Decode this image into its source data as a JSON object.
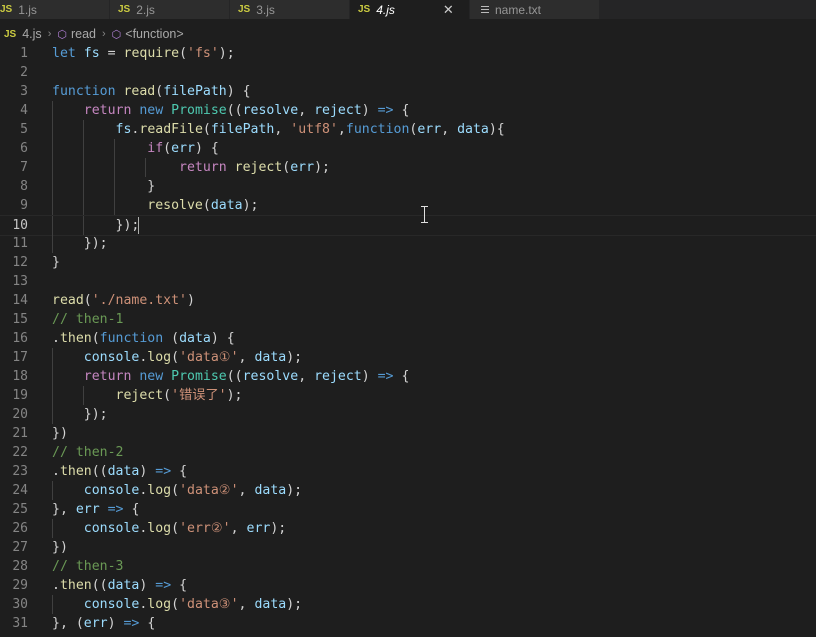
{
  "tabs": [
    {
      "badge": "JS",
      "label": "1.js"
    },
    {
      "badge": "JS",
      "label": "2.js"
    },
    {
      "badge": "JS",
      "label": "3.js"
    },
    {
      "badge": "JS",
      "label": "4.js",
      "active": true
    },
    {
      "icon": "text-file-icon",
      "label": "name.txt"
    }
  ],
  "breadcrumb": {
    "badge": "JS",
    "file": "4.js",
    "symbol1": "read",
    "symbol2": "<function>"
  },
  "editor": {
    "current_line": 10,
    "lines": [
      {
        "n": "1",
        "tokens": [
          [
            "kw",
            "let"
          ],
          [
            "pun",
            " "
          ],
          [
            "var",
            "fs"
          ],
          [
            "pun",
            " = "
          ],
          [
            "fn",
            "require"
          ],
          [
            "pun",
            "("
          ],
          [
            "str",
            "'fs'"
          ],
          [
            "pun",
            ");"
          ]
        ]
      },
      {
        "n": "2",
        "tokens": []
      },
      {
        "n": "3",
        "tokens": [
          [
            "kw",
            "function"
          ],
          [
            "pun",
            " "
          ],
          [
            "fn",
            "read"
          ],
          [
            "pun",
            "("
          ],
          [
            "var",
            "filePath"
          ],
          [
            "pun",
            ") {"
          ]
        ]
      },
      {
        "n": "4",
        "tokens": [
          [
            "pun",
            "    "
          ],
          [
            "ctl",
            "return"
          ],
          [
            "pun",
            " "
          ],
          [
            "kw",
            "new"
          ],
          [
            "pun",
            " "
          ],
          [
            "cls",
            "Promise"
          ],
          [
            "pun",
            "(("
          ],
          [
            "var",
            "resolve"
          ],
          [
            "pun",
            ", "
          ],
          [
            "var",
            "reject"
          ],
          [
            "pun",
            ") "
          ],
          [
            "kw",
            "=>"
          ],
          [
            "pun",
            " {"
          ]
        ]
      },
      {
        "n": "5",
        "tokens": [
          [
            "pun",
            "        "
          ],
          [
            "var",
            "fs"
          ],
          [
            "pun",
            "."
          ],
          [
            "fn",
            "readFile"
          ],
          [
            "pun",
            "("
          ],
          [
            "var",
            "filePath"
          ],
          [
            "pun",
            ", "
          ],
          [
            "str",
            "'utf8'"
          ],
          [
            "pun",
            ","
          ],
          [
            "kw",
            "function"
          ],
          [
            "pun",
            "("
          ],
          [
            "var",
            "err"
          ],
          [
            "pun",
            ", "
          ],
          [
            "var",
            "data"
          ],
          [
            "pun",
            "){"
          ]
        ]
      },
      {
        "n": "6",
        "tokens": [
          [
            "pun",
            "            "
          ],
          [
            "ctl",
            "if"
          ],
          [
            "pun",
            "("
          ],
          [
            "var",
            "err"
          ],
          [
            "pun",
            ") {"
          ]
        ]
      },
      {
        "n": "7",
        "tokens": [
          [
            "pun",
            "                "
          ],
          [
            "ctl",
            "return"
          ],
          [
            "pun",
            " "
          ],
          [
            "fn",
            "reject"
          ],
          [
            "pun",
            "("
          ],
          [
            "var",
            "err"
          ],
          [
            "pun",
            ");"
          ]
        ]
      },
      {
        "n": "8",
        "tokens": [
          [
            "pun",
            "            }"
          ]
        ]
      },
      {
        "n": "9",
        "tokens": [
          [
            "pun",
            "            "
          ],
          [
            "fn",
            "resolve"
          ],
          [
            "pun",
            "("
          ],
          [
            "var",
            "data"
          ],
          [
            "pun",
            ");"
          ]
        ]
      },
      {
        "n": "10",
        "tokens": [
          [
            "pun",
            "        });"
          ]
        ]
      },
      {
        "n": "11",
        "tokens": [
          [
            "pun",
            "    });"
          ]
        ]
      },
      {
        "n": "12",
        "tokens": [
          [
            "pun",
            "}"
          ]
        ]
      },
      {
        "n": "13",
        "tokens": []
      },
      {
        "n": "14",
        "tokens": [
          [
            "fn",
            "read"
          ],
          [
            "pun",
            "("
          ],
          [
            "str",
            "'./name.txt'"
          ],
          [
            "pun",
            ")"
          ]
        ]
      },
      {
        "n": "15",
        "tokens": [
          [
            "com",
            "// then-1"
          ]
        ]
      },
      {
        "n": "16",
        "tokens": [
          [
            "pun",
            "."
          ],
          [
            "fn",
            "then"
          ],
          [
            "pun",
            "("
          ],
          [
            "kw",
            "function"
          ],
          [
            "pun",
            " ("
          ],
          [
            "var",
            "data"
          ],
          [
            "pun",
            ") {"
          ]
        ]
      },
      {
        "n": "17",
        "tokens": [
          [
            "pun",
            "    "
          ],
          [
            "var",
            "console"
          ],
          [
            "pun",
            "."
          ],
          [
            "fn",
            "log"
          ],
          [
            "pun",
            "("
          ],
          [
            "str",
            "'data①'"
          ],
          [
            "pun",
            ", "
          ],
          [
            "var",
            "data"
          ],
          [
            "pun",
            ");"
          ]
        ]
      },
      {
        "n": "18",
        "tokens": [
          [
            "pun",
            "    "
          ],
          [
            "ctl",
            "return"
          ],
          [
            "pun",
            " "
          ],
          [
            "kw",
            "new"
          ],
          [
            "pun",
            " "
          ],
          [
            "cls",
            "Promise"
          ],
          [
            "pun",
            "(("
          ],
          [
            "var",
            "resolve"
          ],
          [
            "pun",
            ", "
          ],
          [
            "var",
            "reject"
          ],
          [
            "pun",
            ") "
          ],
          [
            "kw",
            "=>"
          ],
          [
            "pun",
            " {"
          ]
        ]
      },
      {
        "n": "19",
        "tokens": [
          [
            "pun",
            "        "
          ],
          [
            "fn",
            "reject"
          ],
          [
            "pun",
            "("
          ],
          [
            "str",
            "'错误了'"
          ],
          [
            "pun",
            ");"
          ]
        ]
      },
      {
        "n": "20",
        "tokens": [
          [
            "pun",
            "    });"
          ]
        ]
      },
      {
        "n": "21",
        "tokens": [
          [
            "pun",
            "})"
          ]
        ]
      },
      {
        "n": "22",
        "tokens": [
          [
            "com",
            "// then-2"
          ]
        ]
      },
      {
        "n": "23",
        "tokens": [
          [
            "pun",
            "."
          ],
          [
            "fn",
            "then"
          ],
          [
            "pun",
            "(("
          ],
          [
            "var",
            "data"
          ],
          [
            "pun",
            ") "
          ],
          [
            "kw",
            "=>"
          ],
          [
            "pun",
            " {"
          ]
        ]
      },
      {
        "n": "24",
        "tokens": [
          [
            "pun",
            "    "
          ],
          [
            "var",
            "console"
          ],
          [
            "pun",
            "."
          ],
          [
            "fn",
            "log"
          ],
          [
            "pun",
            "("
          ],
          [
            "str",
            "'data②'"
          ],
          [
            "pun",
            ", "
          ],
          [
            "var",
            "data"
          ],
          [
            "pun",
            ");"
          ]
        ]
      },
      {
        "n": "25",
        "tokens": [
          [
            "pun",
            "}, "
          ],
          [
            "var",
            "err"
          ],
          [
            "pun",
            " "
          ],
          [
            "kw",
            "=>"
          ],
          [
            "pun",
            " {"
          ]
        ]
      },
      {
        "n": "26",
        "tokens": [
          [
            "pun",
            "    "
          ],
          [
            "var",
            "console"
          ],
          [
            "pun",
            "."
          ],
          [
            "fn",
            "log"
          ],
          [
            "pun",
            "("
          ],
          [
            "str",
            "'err②'"
          ],
          [
            "pun",
            ", "
          ],
          [
            "var",
            "err"
          ],
          [
            "pun",
            ");"
          ]
        ]
      },
      {
        "n": "27",
        "tokens": [
          [
            "pun",
            "})"
          ]
        ]
      },
      {
        "n": "28",
        "tokens": [
          [
            "com",
            "// then-3"
          ]
        ]
      },
      {
        "n": "29",
        "tokens": [
          [
            "pun",
            "."
          ],
          [
            "fn",
            "then"
          ],
          [
            "pun",
            "(("
          ],
          [
            "var",
            "data"
          ],
          [
            "pun",
            ") "
          ],
          [
            "kw",
            "=>"
          ],
          [
            "pun",
            " {"
          ]
        ]
      },
      {
        "n": "30",
        "tokens": [
          [
            "pun",
            "    "
          ],
          [
            "var",
            "console"
          ],
          [
            "pun",
            "."
          ],
          [
            "fn",
            "log"
          ],
          [
            "pun",
            "("
          ],
          [
            "str",
            "'data③'"
          ],
          [
            "pun",
            ", "
          ],
          [
            "var",
            "data"
          ],
          [
            "pun",
            ");"
          ]
        ]
      },
      {
        "n": "31",
        "tokens": [
          [
            "pun",
            "}, ("
          ],
          [
            "var",
            "err"
          ],
          [
            "pun",
            ") "
          ],
          [
            "kw",
            "=>"
          ],
          [
            "pun",
            " {"
          ]
        ]
      }
    ]
  },
  "colors": {
    "background": "#1e1e1e",
    "keyword": "#569cd6",
    "control": "#c586c0",
    "function": "#dcdcaa",
    "variable": "#9cdcfe",
    "string": "#ce9178",
    "class": "#4ec9b0",
    "comment": "#6a9955",
    "js_badge": "#cbcb41"
  }
}
